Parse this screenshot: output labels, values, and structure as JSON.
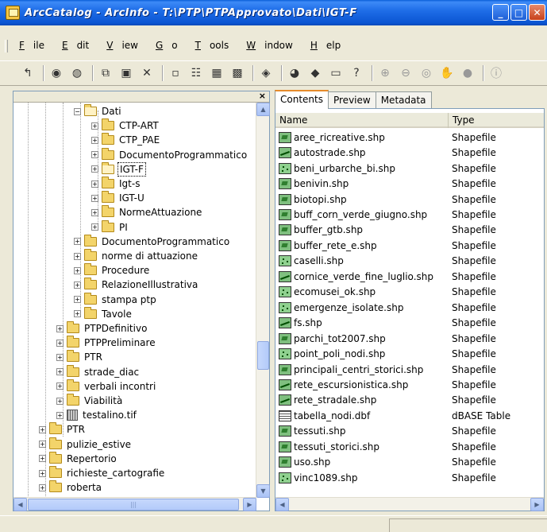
{
  "window": {
    "title": "ArcCatalog - ArcInfo - T:\\PTP\\PTPApprovato\\Dati\\IGT-F",
    "btn_minimize": "_",
    "btn_maximize": "□",
    "btn_close": "✕"
  },
  "menu": [
    {
      "key": "F",
      "rest": "ile"
    },
    {
      "key": "E",
      "rest": "dit"
    },
    {
      "key": "V",
      "rest": "iew"
    },
    {
      "key": "G",
      "rest": "o"
    },
    {
      "key": "T",
      "rest": "ools"
    },
    {
      "key": "W",
      "rest": "indow"
    },
    {
      "key": "H",
      "rest": "elp"
    }
  ],
  "toolbar": {
    "up": "↰",
    "connect": "◉",
    "disconnect": "◍",
    "copy": "⧉",
    "paste": "▣",
    "delete": "✕",
    "large_icons": "▫",
    "list": "☷",
    "details": "▦",
    "thumbnails": "▩",
    "launch": "◈",
    "search": "◕",
    "arctoolbox": "◆",
    "command": "▭",
    "whats_this": "?",
    "zoom_in": "⊕",
    "zoom_out": "⊖",
    "full_extent": "◎",
    "pan": "✋",
    "globe": "●",
    "identify": "ⓘ"
  },
  "tree": {
    "close_label": "×",
    "items": [
      {
        "label": "Dati",
        "exp": "−",
        "icon": "folder-open"
      },
      {
        "label": "CTP-ART",
        "exp": "+",
        "icon": "folder"
      },
      {
        "label": "CTP_PAE",
        "exp": "+",
        "icon": "folder"
      },
      {
        "label": "DocumentoProgrammatico",
        "exp": "+",
        "icon": "folder"
      },
      {
        "label": "IGT-F",
        "exp": "+",
        "icon": "folder-open",
        "selected": true
      },
      {
        "label": "Igt-s",
        "exp": "+",
        "icon": "folder"
      },
      {
        "label": "IGT-U",
        "exp": "+",
        "icon": "folder"
      },
      {
        "label": "NormeAttuazione",
        "exp": "+",
        "icon": "folder"
      },
      {
        "label": "PI",
        "exp": "+",
        "icon": "folder"
      },
      {
        "label": "DocumentoProgrammatico",
        "exp": "+",
        "icon": "folder"
      },
      {
        "label": "norme di attuazione",
        "exp": "+",
        "icon": "folder"
      },
      {
        "label": "Procedure",
        "exp": "+",
        "icon": "folder"
      },
      {
        "label": "RelazioneIllustrativa",
        "exp": "+",
        "icon": "folder"
      },
      {
        "label": "stampa ptp",
        "exp": "+",
        "icon": "folder"
      },
      {
        "label": "Tavole",
        "exp": "+",
        "icon": "folder"
      },
      {
        "label": "PTPDefinitivo",
        "exp": "+",
        "icon": "folder"
      },
      {
        "label": "PTPPreliminare",
        "exp": "+",
        "icon": "folder"
      },
      {
        "label": "PTR",
        "exp": "+",
        "icon": "folder"
      },
      {
        "label": "strade_diac",
        "exp": "+",
        "icon": "folder"
      },
      {
        "label": "verbali incontri",
        "exp": "+",
        "icon": "folder"
      },
      {
        "label": "Viabilità",
        "exp": "+",
        "icon": "folder"
      },
      {
        "label": "testalino.tif",
        "exp": "+",
        "icon": "raster"
      },
      {
        "label": "PTR",
        "exp": "+",
        "icon": "folder"
      },
      {
        "label": "pulizie_estive",
        "exp": "+",
        "icon": "folder"
      },
      {
        "label": "Repertorio",
        "exp": "+",
        "icon": "folder"
      },
      {
        "label": "richieste_cartografie",
        "exp": "+",
        "icon": "folder"
      },
      {
        "label": "roberta",
        "exp": "+",
        "icon": "folder"
      }
    ]
  },
  "tabs": [
    "Contents",
    "Preview",
    "Metadata"
  ],
  "list": {
    "col_name": "Name",
    "col_type": "Type",
    "rows": [
      {
        "name": "aree_ricreative.shp",
        "type": "Shapefile",
        "icon": "polygon"
      },
      {
        "name": "autostrade.shp",
        "type": "Shapefile",
        "icon": "line"
      },
      {
        "name": "beni_urbarche_bi.shp",
        "type": "Shapefile",
        "icon": "point"
      },
      {
        "name": "benivin.shp",
        "type": "Shapefile",
        "icon": "polygon"
      },
      {
        "name": "biotopi.shp",
        "type": "Shapefile",
        "icon": "polygon"
      },
      {
        "name": "buff_corn_verde_giugno.shp",
        "type": "Shapefile",
        "icon": "polygon"
      },
      {
        "name": "buffer_gtb.shp",
        "type": "Shapefile",
        "icon": "polygon"
      },
      {
        "name": "buffer_rete_e.shp",
        "type": "Shapefile",
        "icon": "polygon"
      },
      {
        "name": "caselli.shp",
        "type": "Shapefile",
        "icon": "point"
      },
      {
        "name": "cornice_verde_fine_luglio.shp",
        "type": "Shapefile",
        "icon": "line"
      },
      {
        "name": "ecomusei_ok.shp",
        "type": "Shapefile",
        "icon": "point"
      },
      {
        "name": "emergenze_isolate.shp",
        "type": "Shapefile",
        "icon": "point"
      },
      {
        "name": "fs.shp",
        "type": "Shapefile",
        "icon": "line"
      },
      {
        "name": "parchi_tot2007.shp",
        "type": "Shapefile",
        "icon": "polygon"
      },
      {
        "name": "point_poli_nodi.shp",
        "type": "Shapefile",
        "icon": "point"
      },
      {
        "name": "principali_centri_storici.shp",
        "type": "Shapefile",
        "icon": "polygon"
      },
      {
        "name": "rete_escursionistica.shp",
        "type": "Shapefile",
        "icon": "line"
      },
      {
        "name": "rete_stradale.shp",
        "type": "Shapefile",
        "icon": "line"
      },
      {
        "name": "tabella_nodi.dbf",
        "type": "dBASE Table",
        "icon": "table"
      },
      {
        "name": "tessuti.shp",
        "type": "Shapefile",
        "icon": "polygon"
      },
      {
        "name": "tessuti_storici.shp",
        "type": "Shapefile",
        "icon": "polygon"
      },
      {
        "name": "uso.shp",
        "type": "Shapefile",
        "icon": "polygon"
      },
      {
        "name": "vinc1089.shp",
        "type": "Shapefile",
        "icon": "point"
      }
    ]
  },
  "scroll": {
    "up": "▲",
    "down": "▼",
    "left": "◀",
    "right": "▶",
    "grip": "|||"
  }
}
